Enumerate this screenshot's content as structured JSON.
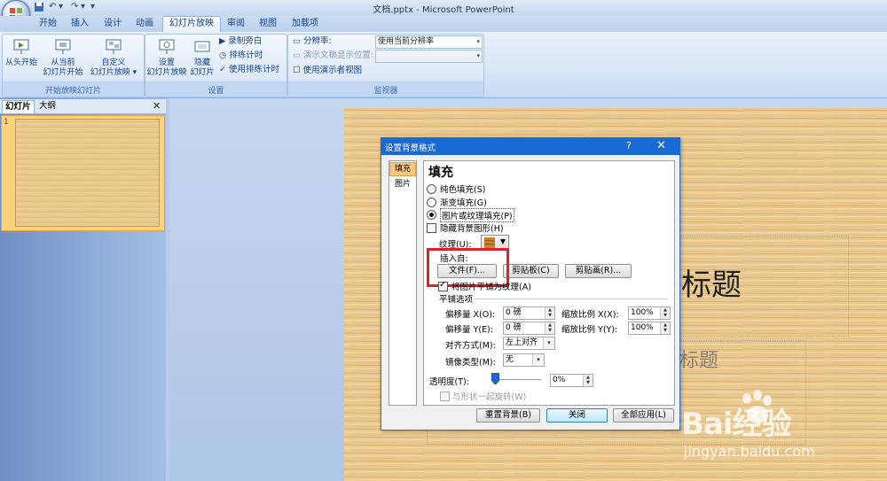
{
  "window": {
    "title": "文档.pptx - Microsoft PowerPoint"
  },
  "qat": {
    "undo_glyph": "↶",
    "redo_glyph": "↷",
    "more_glyph": "▾"
  },
  "tabs": [
    "开始",
    "插入",
    "设计",
    "动画",
    "幻灯片放映",
    "审阅",
    "视图",
    "加载项"
  ],
  "active_tab": "幻灯片放映",
  "ribbon": {
    "group_start": {
      "label": "开始放映幻灯片",
      "from_start": "从头开始",
      "from_current_1": "从当前",
      "from_current_2": "幻灯片开始",
      "custom_1": "自定义",
      "custom_2": "幻灯片放映 ▾"
    },
    "group_setup": {
      "label": "设置",
      "setup_1": "设置",
      "setup_2": "幻灯片放映",
      "hide_1": "隐藏",
      "hide_2": "幻灯片",
      "record": "录制旁白",
      "rehearse": "排练计时",
      "use_timings": "使用排练计时"
    },
    "group_monitor": {
      "label": "监视器",
      "resolution_label": "分辨率:",
      "resolution_value": "使用当前分辨率",
      "show_on_label": "演示文稿显示位置:",
      "show_on_value": "",
      "presenter_view": "使用演示者视图"
    }
  },
  "left_pane": {
    "tab_slides": "幻灯片",
    "tab_outline": "大纲",
    "close": "✕",
    "slide_number": "1"
  },
  "slide": {
    "title_text": "标题",
    "subtitle_text": "标题"
  },
  "watermark": {
    "brand": "Bai经验",
    "url": "jingyan.baidu.com"
  },
  "dialog": {
    "title": "设置背景格式",
    "help": "?",
    "close": "✕",
    "nav": [
      "填充",
      "图片"
    ],
    "section_title": "填充",
    "options": {
      "solid": "纯色填充(S)",
      "gradient": "渐变填充(G)",
      "picture": "图片或纹理填充(P)",
      "hide_bg": "隐藏背景图形(H)"
    },
    "texture_label": "纹理(U):",
    "insert_from_label": "插入自:",
    "file_btn": "文件(F)...",
    "clipboard_btn": "剪贴板(C)",
    "clipart_btn": "剪贴画(R)...",
    "tile_check": "将图片平铺为纹理(A)",
    "tile_options_label": "平铺选项",
    "offset_x_label": "偏移量 X(O):",
    "offset_x_value": "0 磅",
    "offset_y_label": "偏移量 Y(E):",
    "offset_y_value": "0 磅",
    "scale_x_label": "缩放比例 X(X):",
    "scale_x_value": "100%",
    "scale_y_label": "缩放比例 Y(Y):",
    "scale_y_value": "100%",
    "align_label": "对齐方式(M):",
    "align_value": "左上对齐",
    "mirror_label": "镜像类型(M):",
    "mirror_value": "无",
    "transparency_label": "透明度(T):",
    "transparency_value": "0%",
    "transparency_level": 0,
    "rotate_label": "与形状一起旋转(W)",
    "reset_btn": "重置背景(B)",
    "close_btn": "关闭",
    "apply_all_btn": "全部应用(L)"
  }
}
